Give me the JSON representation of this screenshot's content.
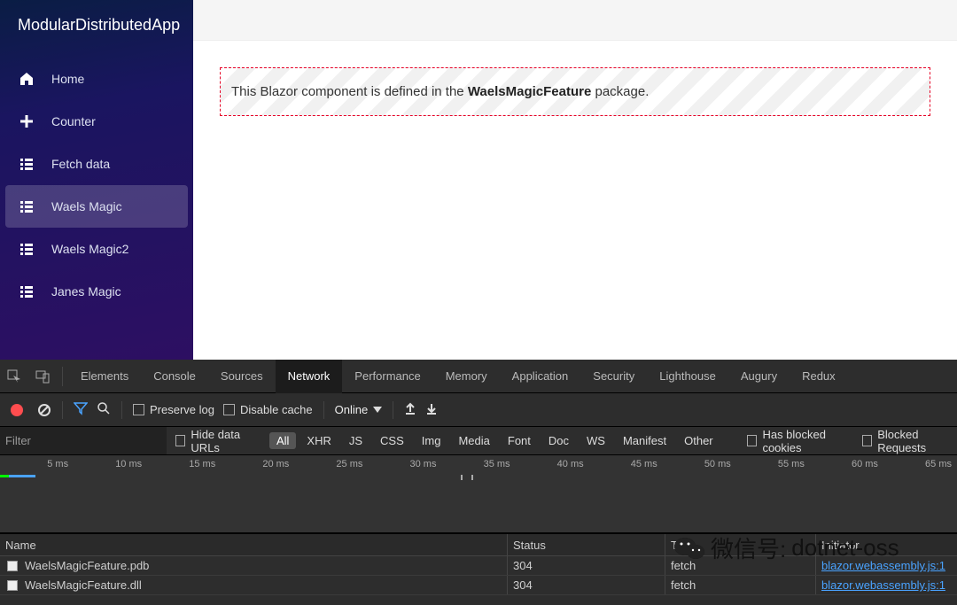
{
  "app": {
    "title": "ModularDistributedApp",
    "nav": [
      {
        "label": "Home",
        "icon": "home"
      },
      {
        "label": "Counter",
        "icon": "plus"
      },
      {
        "label": "Fetch data",
        "icon": "list"
      },
      {
        "label": "Waels Magic",
        "icon": "list"
      },
      {
        "label": "Waels Magic2",
        "icon": "list"
      },
      {
        "label": "Janes Magic",
        "icon": "list"
      }
    ],
    "nav_active_index": 3,
    "alert_prefix": "This Blazor component is defined in the ",
    "alert_bold": "WaelsMagicFeature",
    "alert_suffix": " package."
  },
  "devtools": {
    "tabs": [
      "Elements",
      "Console",
      "Sources",
      "Network",
      "Performance",
      "Memory",
      "Application",
      "Security",
      "Lighthouse",
      "Augury",
      "Redux"
    ],
    "active_tab": "Network",
    "toolbar": {
      "preserve_log": "Preserve log",
      "disable_cache": "Disable cache",
      "throttling": "Online"
    },
    "filter": {
      "placeholder": "Filter",
      "hide_data_urls": "Hide data URLs",
      "types": [
        "All",
        "XHR",
        "JS",
        "CSS",
        "Img",
        "Media",
        "Font",
        "Doc",
        "WS",
        "Manifest",
        "Other"
      ],
      "types_active": "All",
      "has_blocked_cookies": "Has blocked cookies",
      "blocked_requests": "Blocked Requests"
    },
    "timeline_ticks": [
      "5 ms",
      "10 ms",
      "15 ms",
      "20 ms",
      "25 ms",
      "30 ms",
      "35 ms",
      "40 ms",
      "45 ms",
      "50 ms",
      "55 ms",
      "60 ms",
      "65 ms"
    ],
    "columns": {
      "name": "Name",
      "status": "Status",
      "type": "Type",
      "initiator": "Initiator"
    },
    "rows": [
      {
        "name": "WaelsMagicFeature.pdb",
        "status": "304",
        "type": "fetch",
        "initiator": "blazor.webassembly.js:1"
      },
      {
        "name": "WaelsMagicFeature.dll",
        "status": "304",
        "type": "fetch",
        "initiator": "blazor.webassembly.js:1"
      }
    ]
  },
  "watermark": {
    "label": "微信号:",
    "value": "dotnet-oss"
  }
}
